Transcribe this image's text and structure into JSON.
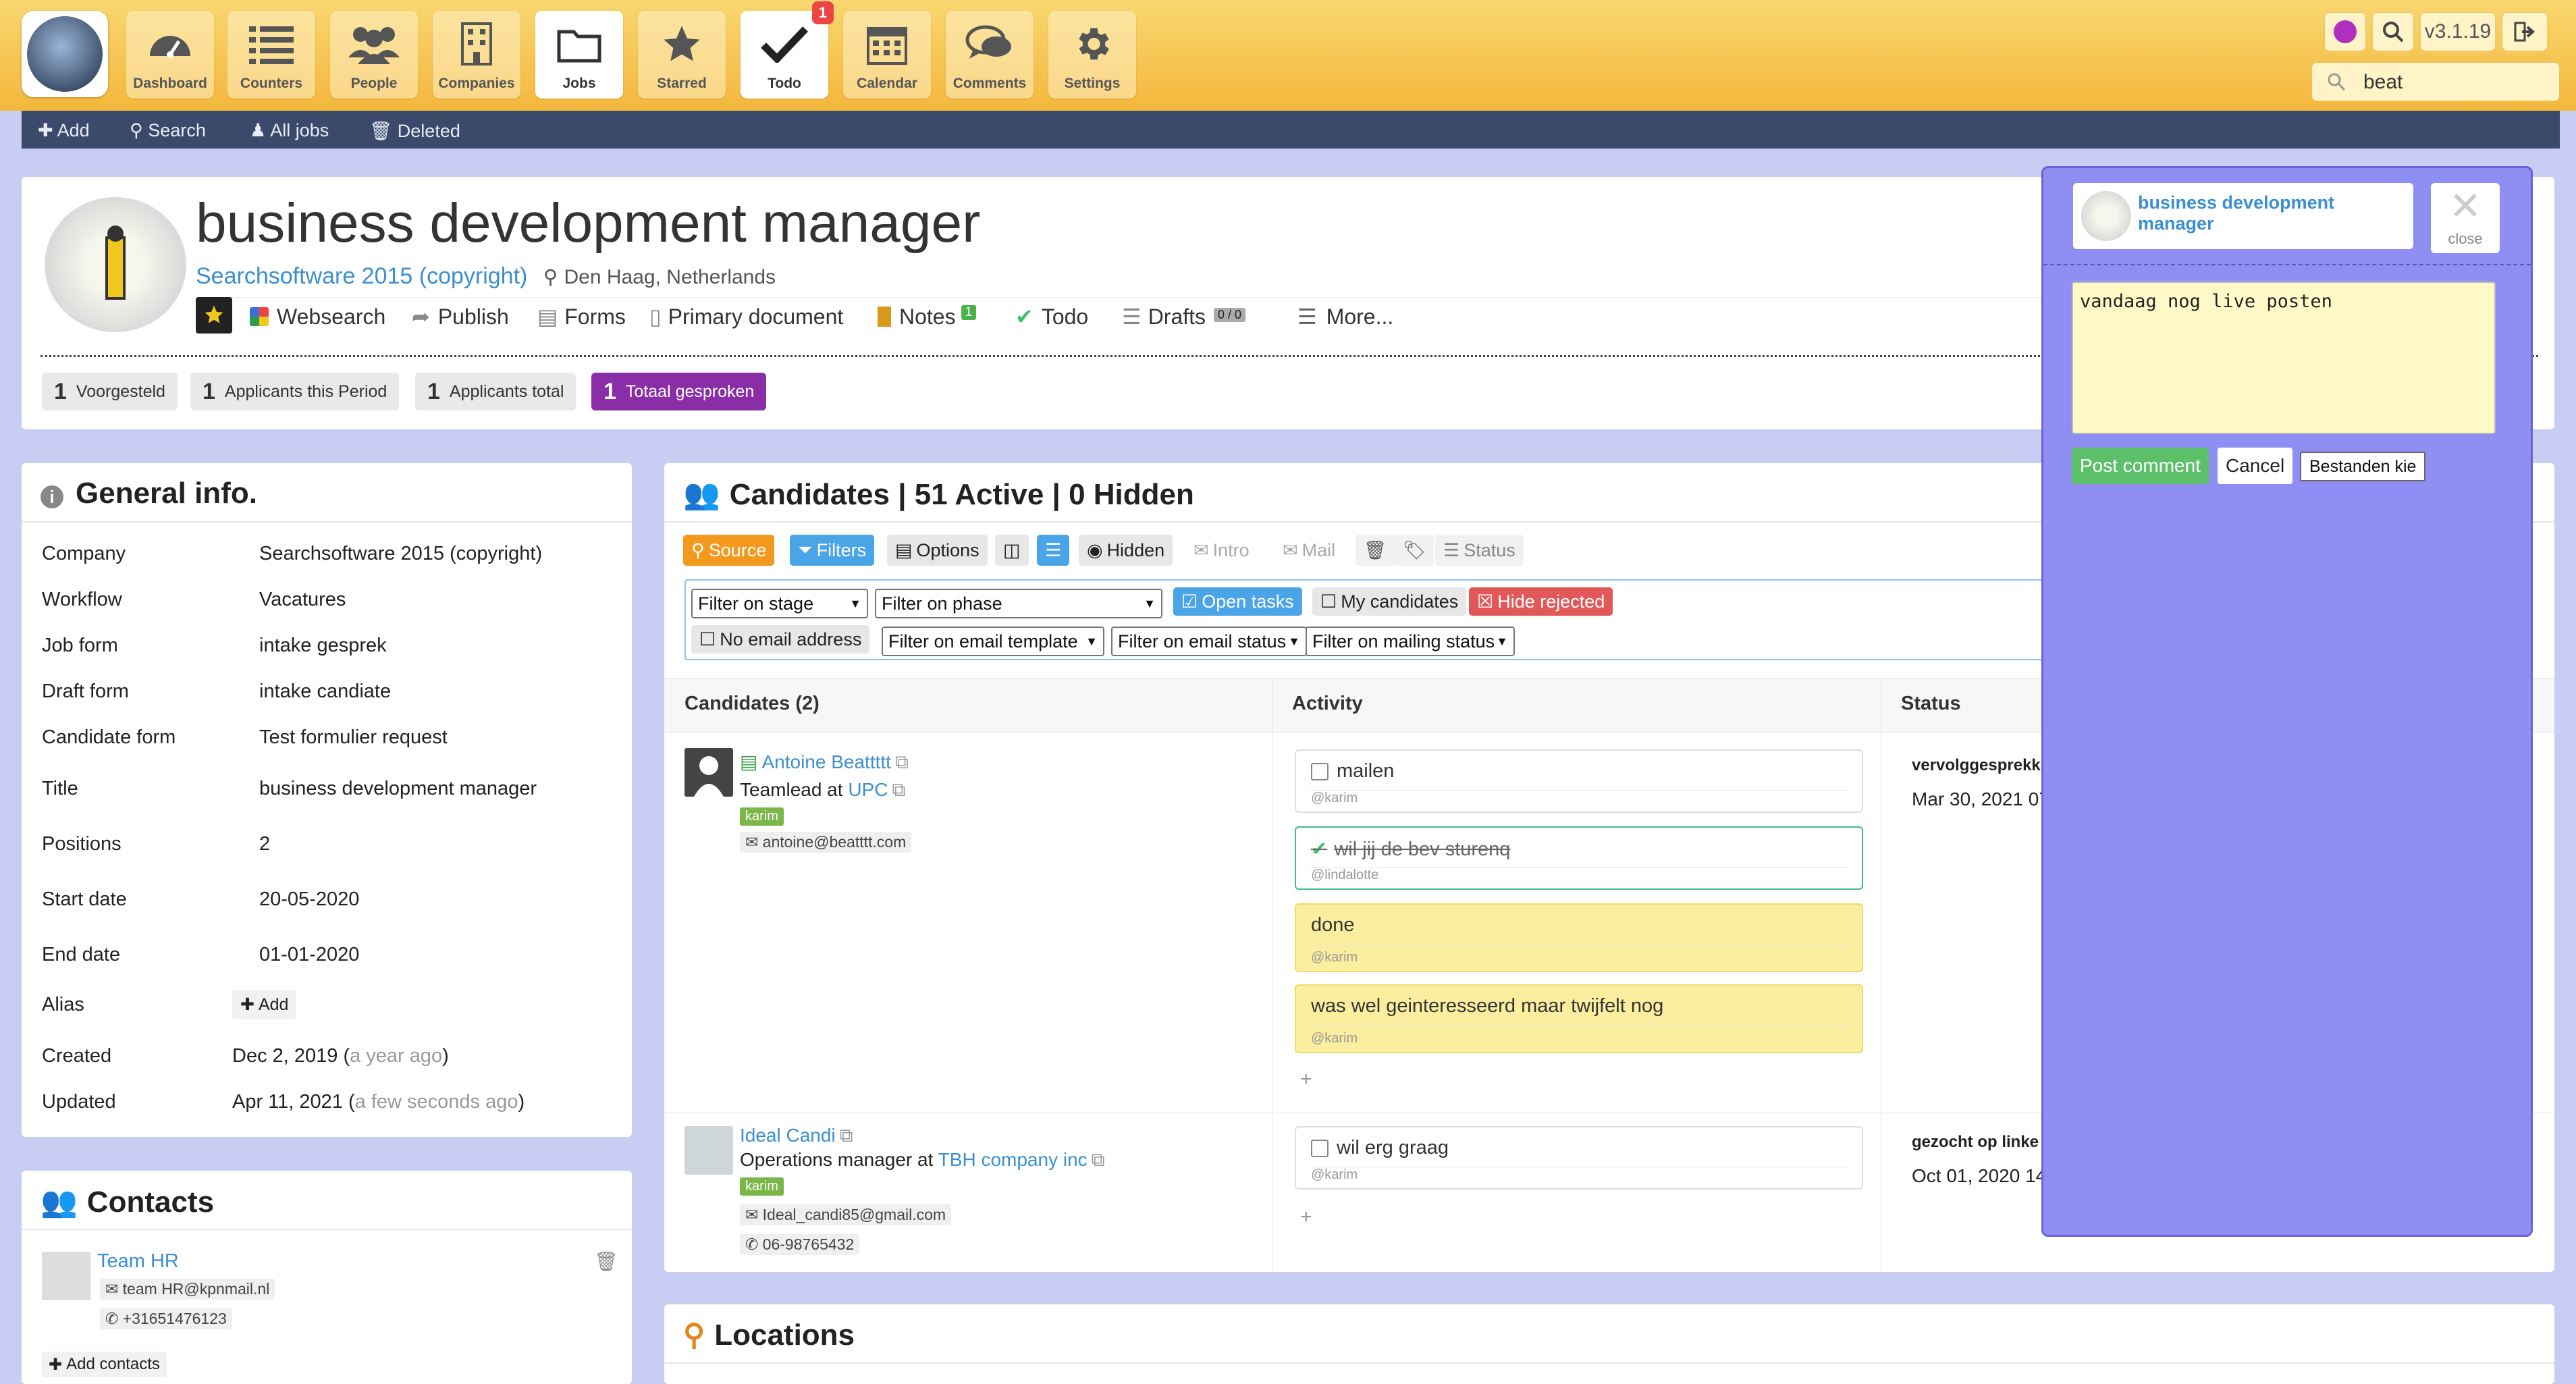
{
  "app": {
    "version": "v3.1.19",
    "search_value": "beat"
  },
  "nav": [
    {
      "label": "Dashboard",
      "icon": "dashboard-icon"
    },
    {
      "label": "Counters",
      "icon": "list-icon"
    },
    {
      "label": "People",
      "icon": "people-icon"
    },
    {
      "label": "Companies",
      "icon": "building-icon"
    },
    {
      "label": "Jobs",
      "icon": "folder-icon"
    },
    {
      "label": "Starred",
      "icon": "star-icon"
    },
    {
      "label": "Todo",
      "icon": "check-icon",
      "badge": "1"
    },
    {
      "label": "Calendar",
      "icon": "calendar-icon"
    },
    {
      "label": "Comments",
      "icon": "comments-icon"
    },
    {
      "label": "Settings",
      "icon": "gear-icon"
    }
  ],
  "subnav": {
    "add": "Add",
    "search": "Search",
    "all_jobs": "All jobs",
    "deleted": "Deleted"
  },
  "job": {
    "title": "business development manager",
    "company": "Searchsoftware 2015 (copyright)",
    "location": "Den Haag, Netherlands",
    "tabs": {
      "websearch": "Websearch",
      "publish": "Publish",
      "forms": "Forms",
      "primary_document": "Primary document",
      "notes": "Notes",
      "notes_count": "1",
      "todo": "Todo",
      "drafts": "Drafts",
      "drafts_count": "0 / 0",
      "more": "More..."
    },
    "stats": [
      {
        "count": "1",
        "label": "Voorgesteld"
      },
      {
        "count": "1",
        "label": "Applicants this Period"
      },
      {
        "count": "1",
        "label": "Applicants total"
      },
      {
        "count": "1",
        "label": "Totaal gesproken"
      }
    ]
  },
  "general": {
    "title": "General info.",
    "rows": [
      {
        "label": "Company",
        "value": "Searchsoftware 2015 (copyright)"
      },
      {
        "label": "Workflow",
        "value": "Vacatures"
      },
      {
        "label": "Job form",
        "value": "intake gesprek"
      },
      {
        "label": "Draft form",
        "value": "intake candiate"
      },
      {
        "label": "Candidate form",
        "value": "Test formulier request"
      },
      {
        "label": "Title",
        "value": "business development manager"
      },
      {
        "label": "Positions",
        "value": "2"
      },
      {
        "label": "Start date",
        "value": "20-05-2020"
      },
      {
        "label": "End date",
        "value": "01-01-2020"
      }
    ],
    "alias_label": "Alias",
    "alias_add": "Add",
    "created_label": "Created",
    "created": "Dec 2, 2019",
    "created_ago": "a year ago",
    "updated_label": "Updated",
    "updated": "Apr 11, 2021",
    "updated_ago": "a few seconds ago"
  },
  "contacts": {
    "title": "Contacts",
    "name": "Team HR",
    "email": "team HR@kpnmail.nl",
    "phone": "+31651476123",
    "add": "Add contacts"
  },
  "candidates": {
    "title": "Candidates | 51 Active | 0 Hidden",
    "toolbar": {
      "source": "Source",
      "filters": "Filters",
      "options": "Options",
      "hidden": "Hidden",
      "intro": "Intro",
      "mail": "Mail",
      "status": "Status"
    },
    "filters": {
      "stage": "Filter on stage",
      "phase": "Filter on phase",
      "open_tasks": "Open tasks",
      "my_candidates": "My candidates",
      "hide_rejected": "Hide rejected",
      "no_email": "No email address",
      "email_template": "Filter on email template",
      "email_status": "Filter on email status",
      "mailing_status": "Filter on mailing status"
    },
    "columns": {
      "candidates": "Candidates (2)",
      "activity": "Activity",
      "status": "Status"
    },
    "list": [
      {
        "name": "Antoine Beattttt",
        "role": "Teamlead at",
        "company": "UPC",
        "tag": "karim",
        "email": "antoine@beatttt.com",
        "activities": [
          {
            "text": "mailen",
            "user": "@karim"
          },
          {
            "text": "wil jij de bev sturenq",
            "user": "@lindalotte"
          },
          {
            "text": "done",
            "user": "@karim"
          },
          {
            "text": "was wel geinteresseerd maar twijfelt nog",
            "user": "@karim"
          }
        ],
        "status": "vervolggesprekk",
        "status_date": "Mar 30, 2021 07"
      },
      {
        "name": "Ideal Candi",
        "role": "Operations manager at",
        "company": "TBH company inc",
        "tag": "karim",
        "email": "Ideal_candi85@gmail.com",
        "phone": "06-98765432",
        "activities": [
          {
            "text": "wil erg graag",
            "user": "@karim"
          }
        ],
        "status": "gezocht op linke",
        "status_date": "Oct 01, 2020 14"
      }
    ]
  },
  "locations": {
    "title": "Locations"
  },
  "popup": {
    "title": "business development manager",
    "close": "close",
    "comment": "vandaag nog live posten",
    "post": "Post comment",
    "cancel": "Cancel",
    "files": "Bestanden kie"
  }
}
